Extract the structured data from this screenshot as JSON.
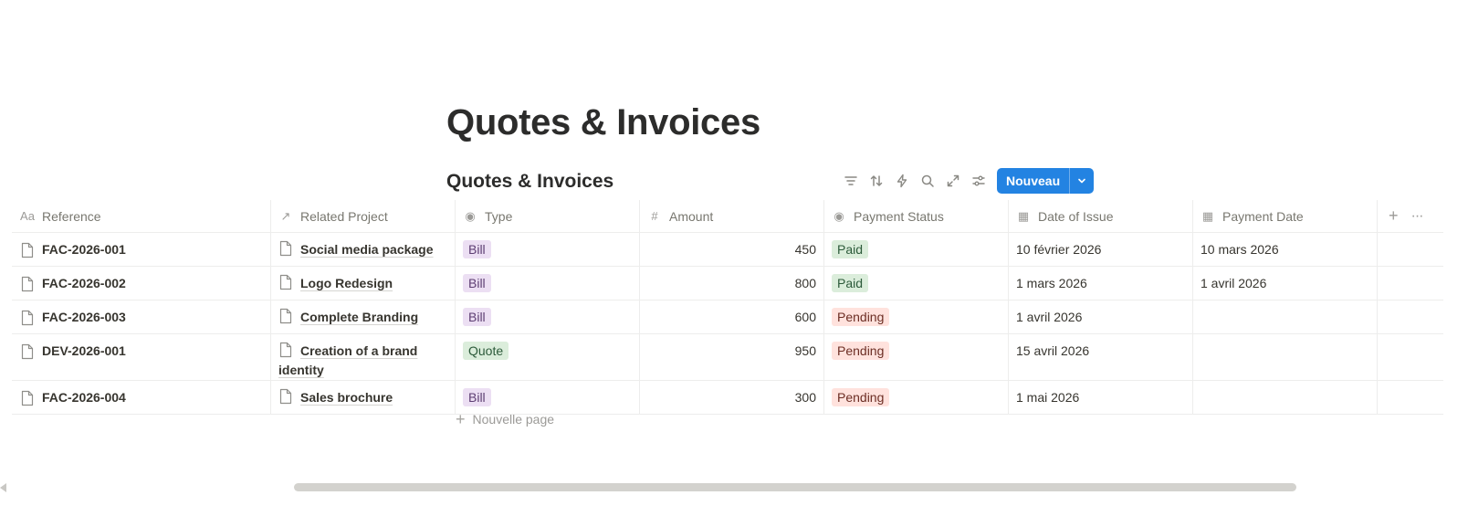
{
  "page": {
    "title": "Quotes & Invoices"
  },
  "database": {
    "title": "Quotes & Invoices",
    "toolbar": {
      "icons": [
        "filter-icon",
        "sort-icon",
        "automation-icon",
        "search-icon",
        "expand-icon",
        "settings-icon"
      ],
      "new_label": "Nouveau"
    },
    "columns": [
      {
        "icon": "text-icon",
        "glyph": "Aa",
        "label": "Reference"
      },
      {
        "icon": "relation-icon",
        "glyph": "↗",
        "label": "Related Project"
      },
      {
        "icon": "select-icon",
        "glyph": "◉",
        "label": "Type"
      },
      {
        "icon": "number-icon",
        "glyph": "#",
        "label": "Amount"
      },
      {
        "icon": "status-icon",
        "glyph": "◉",
        "label": "Payment Status"
      },
      {
        "icon": "calendar-icon",
        "glyph": "▦",
        "label": "Date of Issue"
      },
      {
        "icon": "calendar-icon",
        "glyph": "▦",
        "label": "Payment Date"
      }
    ],
    "rows": [
      {
        "reference": "FAC-2026-001",
        "project": "Social media package",
        "type": "Bill",
        "amount": "450",
        "status": "Paid",
        "issue_date": "10 février 2026",
        "payment_date": "10 mars 2026"
      },
      {
        "reference": "FAC-2026-002",
        "project": "Logo Redesign",
        "type": "Bill",
        "amount": "800",
        "status": "Paid",
        "issue_date": "1 mars 2026",
        "payment_date": "1 avril 2026"
      },
      {
        "reference": "FAC-2026-003",
        "project": "Complete Branding",
        "type": "Bill",
        "amount": "600",
        "status": "Pending",
        "issue_date": "1 avril 2026",
        "payment_date": ""
      },
      {
        "reference": "DEV-2026-001",
        "project": "Creation of a brand identity",
        "type": "Quote",
        "amount": "950",
        "status": "Pending",
        "issue_date": "15 avril 2026",
        "payment_date": ""
      },
      {
        "reference": "FAC-2026-004",
        "project": "Sales brochure",
        "type": "Bill",
        "amount": "300",
        "status": "Pending",
        "issue_date": "1 mai 2026",
        "payment_date": ""
      }
    ],
    "new_page_label": "Nouvelle page"
  },
  "colors": {
    "accent": "#2383e2",
    "tag_bill_bg": "#ecdff3",
    "tag_quote_bg": "#dbeddb",
    "tag_paid_bg": "#dbeddb",
    "tag_pending_bg": "#ffe2dd"
  }
}
